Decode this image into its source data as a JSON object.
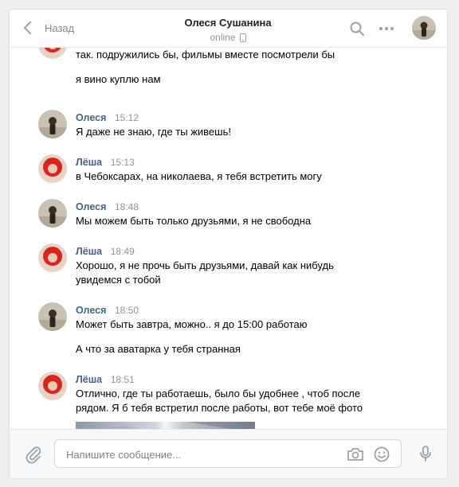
{
  "header": {
    "back_label": "Назад",
    "title": "Олеся Сушанина",
    "status": "online"
  },
  "composer": {
    "placeholder": "Напишите сообщение..."
  },
  "messages": [
    {
      "author": "",
      "time": "",
      "lines": [
        "так. подружились бы, фильмы вместе посмотрели бы"
      ]
    },
    {
      "author": "",
      "time": "",
      "lines": [
        "я вино куплю нам"
      ]
    },
    {
      "author": "Олеся",
      "time": "15:12",
      "lines": [
        "Я даже не знаю, где ты живешь!"
      ]
    },
    {
      "author": "Лёша",
      "time": "15:13",
      "lines": [
        "в Чебоксарах, на николаева, я тебя встретить могу"
      ]
    },
    {
      "author": "Олеся",
      "time": "18:48",
      "lines": [
        "Мы можем быть только друзьями, я не свободна"
      ]
    },
    {
      "author": "Лёша",
      "time": "18:49",
      "lines": [
        "Хорошо, я не прочь быть друзьями, давай как нибудь",
        "увидемся с тобой"
      ]
    },
    {
      "author": "Олеся",
      "time": "18:50",
      "lines": [
        "Может быть завтра, можно.. я до 15:00 работаю"
      ]
    },
    {
      "author": "",
      "time": "",
      "lines": [
        "А что за аватарка у тебя странная"
      ]
    },
    {
      "author": "Лёша",
      "time": "18:51",
      "lines": [
        "Отлично, где ты работаешь, было бы удобнее , чтоб после",
        "рядом. Я б тебя встретил после работы, вот тебе моё фото"
      ]
    }
  ]
}
